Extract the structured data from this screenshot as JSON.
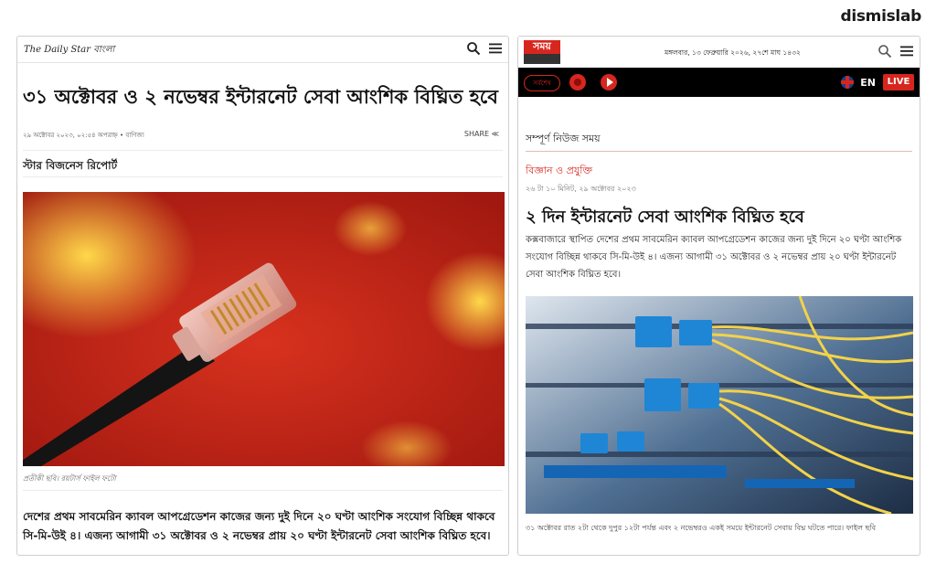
{
  "brand": "dismislab",
  "left": {
    "site_name": "The Daily Star বাংলা",
    "headline": "৩১ অক্টোবর ও ২ নভেম্বর ইন্টারনেট সেবা আংশিক বিঘ্নিত হবে",
    "meta": "২৯ অক্টোবর ২০২৩, ০২:৫৪ অপরাহ্ন • বাণিজ্য",
    "share": "SHARE ≪",
    "byline": "স্টার বিজনেস রিপোর্ট",
    "caption": "প্রতীকী ছবি। রয়টার্স ফাইল ফটো",
    "body": "দেশের প্রথম সাবমেরিন ক্যাবল আপগ্রেডেশন কাজের জন্য দুই দিনে ২০ ঘণ্টা আংশিক সংযোগ বিচ্ছিন্ন থাকবে সি-মি-উই ৪। এজন্য আগামী ৩১ অক্টোবর ও ২ নভেম্বর প্রায় ২০ ঘণ্টা ইন্টারনেট সেবা আংশিক বিঘ্নিত হবে।"
  },
  "right": {
    "logo_text": "সময়",
    "date": "মঙ্গলবার, ১৩ ফেব্রুয়ারি ২০২৬, ২৭শে মাঘ ১৪৩২",
    "pill": "সর্বশেষ",
    "lang": "EN",
    "live": "LIVE",
    "section": "সম্পূর্ণ নিউজ সময়",
    "category": "বিজ্ঞান ও প্রযুক্তি",
    "time": "২৬ টা ১০ মিনিট, ২৯ অক্টোবর ২০২৩",
    "headline": "২ দিন ইন্টারনেট সেবা আংশিক বিঘ্নিত হবে",
    "summary": "কক্সবাজারে স্থাপিত দেশের প্রথম সাবমেরিন ক্যাবল আপগ্রেডেশন কাজের জন্য দুই দিনে ২০ ঘণ্টা আংশিক সংযোগ বিচ্ছিন্ন থাকবে সি-মি-উই ৪। এজন্য আগামী ৩১ অক্টোবর ও ২ নভেম্বর প্রায় ২০ ঘণ্টা ইন্টারনেট সেবা আংশিক বিঘ্নিত হবে।",
    "caption": "৩১ অক্টোবর রাত ২টা থেকে দুপুর ১২টা পর্যন্ত এবং ২ নভেম্বরও একই সময়ে ইন্টারনেট সেবায় বিঘ্ন ঘটতে পারে। ফাইল ছবি"
  },
  "icons": [
    "search-icon",
    "menu-icon",
    "record-icon",
    "play-icon",
    "uk-flag-icon"
  ],
  "colors": {
    "accent": "#d7261e",
    "dark_bar": "#000000"
  }
}
